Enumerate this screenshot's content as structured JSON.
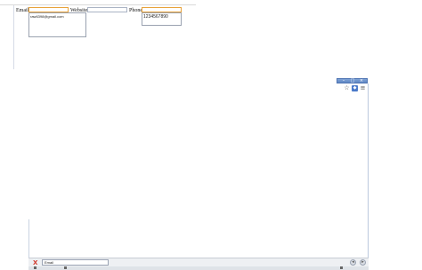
{
  "form": {
    "email_label": "Email:",
    "email_value": "",
    "website_label": "Website:",
    "website_value": "",
    "phone_label": "Phone:",
    "phone_value": "",
    "email_suggestions": [
      "raw6398@gmail.com"
    ],
    "phone_suggestions": [
      "1234567890"
    ]
  },
  "browser": {
    "window_buttons": [
      "–",
      "□",
      "×"
    ],
    "toolbar_icons": [
      "star-icon",
      "extension-icon",
      "menu-icon"
    ],
    "find_bar": {
      "close_label": "X",
      "query": "Email"
    }
  }
}
